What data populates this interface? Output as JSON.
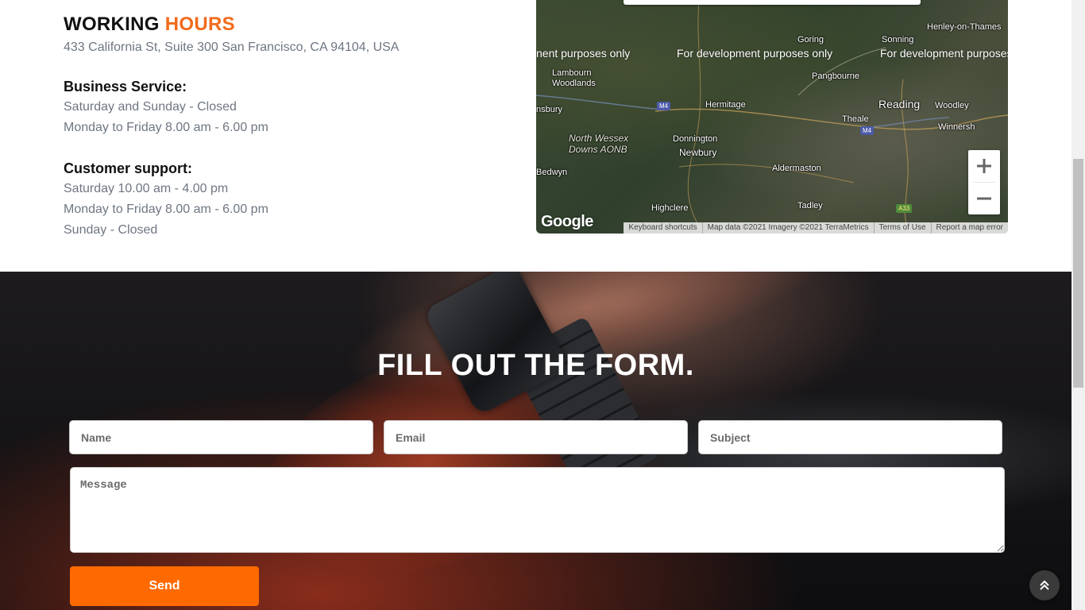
{
  "working_hours": {
    "title_main": "WORKING",
    "title_accent": "HOURS",
    "address": "433 California St, Suite 300 San Francisco, CA 94104, USA",
    "business_service": {
      "heading": "Business Service:",
      "lines": [
        "Saturday and Sunday - Closed",
        "Monday to Friday 8.00 am - 6.00 pm"
      ]
    },
    "customer_support": {
      "heading": "Customer support:",
      "lines": [
        "Saturday 10.00 am - 4.00 pm",
        "Monday to Friday 8.00 am - 6.00 pm",
        "Sunday - Closed"
      ]
    },
    "accent_color": "#f26a1b"
  },
  "map": {
    "dev_watermarks": [
      "nent purposes only",
      "For development purposes only",
      "For development purposes"
    ],
    "places": {
      "goring": "Goring",
      "sonning": "Sonning",
      "henley": "Henley-on-Thames",
      "lambourn": "Lambourn\nWoodlands",
      "pangbourne": "Pangbourne",
      "hermitage": "Hermitage",
      "reading": "Reading",
      "woodley": "Woodley",
      "theale": "Theale",
      "winnersh": "Winnersh",
      "nsbury": "nsbury",
      "north_wessex": "North Wessex\nDowns AONB",
      "donnington": "Donnington",
      "newbury": "Newbury",
      "bedwyn": "Bedwyn",
      "aldermaston": "Aldermaston",
      "highclere": "Highclere",
      "tadley": "Tadley"
    },
    "road_shields": {
      "m4_a": "M4",
      "m4_b": "M4",
      "a33": "A33"
    },
    "logo": "Google",
    "attribution": [
      "Keyboard shortcuts",
      "Map data ©2021 Imagery ©2021 TerraMetrics",
      "Terms of Use",
      "Report a map error"
    ],
    "zoom_in_icon": "plus-icon",
    "zoom_out_icon": "minus-icon"
  },
  "form": {
    "title": "FILL OUT THE FORM.",
    "name_placeholder": "Name",
    "email_placeholder": "Email",
    "subject_placeholder": "Subject",
    "message_placeholder": "Message",
    "send_label": "Send",
    "send_color": "#ff6a00"
  },
  "back_to_top_icon": "double-chevron-up-icon"
}
